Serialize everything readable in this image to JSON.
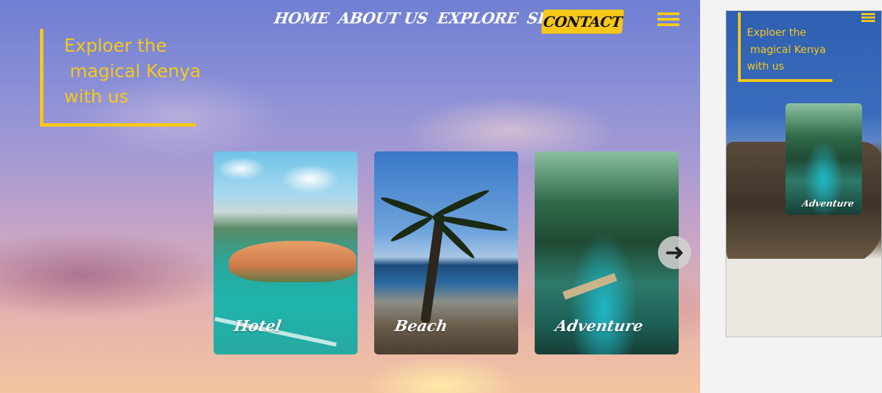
{
  "nav": {
    "items": [
      {
        "label": "HOME"
      },
      {
        "label": "ABOUT US"
      },
      {
        "label": "EXPLORE"
      },
      {
        "label": "SERVICES"
      }
    ],
    "contact_label": "CONTACT"
  },
  "hero": {
    "text": "Exploer the\n magical Kenya\nwith us"
  },
  "cards": [
    {
      "label": "Hotel"
    },
    {
      "label": "Beach"
    },
    {
      "label": "Adventure"
    }
  ],
  "mobile": {
    "hero_text": "Exploer the\n magical Kenya\nwith us",
    "card_label": "Adventure"
  },
  "colors": {
    "accent": "#f7c81a",
    "text_light": "#ffffff"
  },
  "icons": {
    "menu": "hamburger-menu-icon",
    "next": "arrow-right-icon"
  }
}
